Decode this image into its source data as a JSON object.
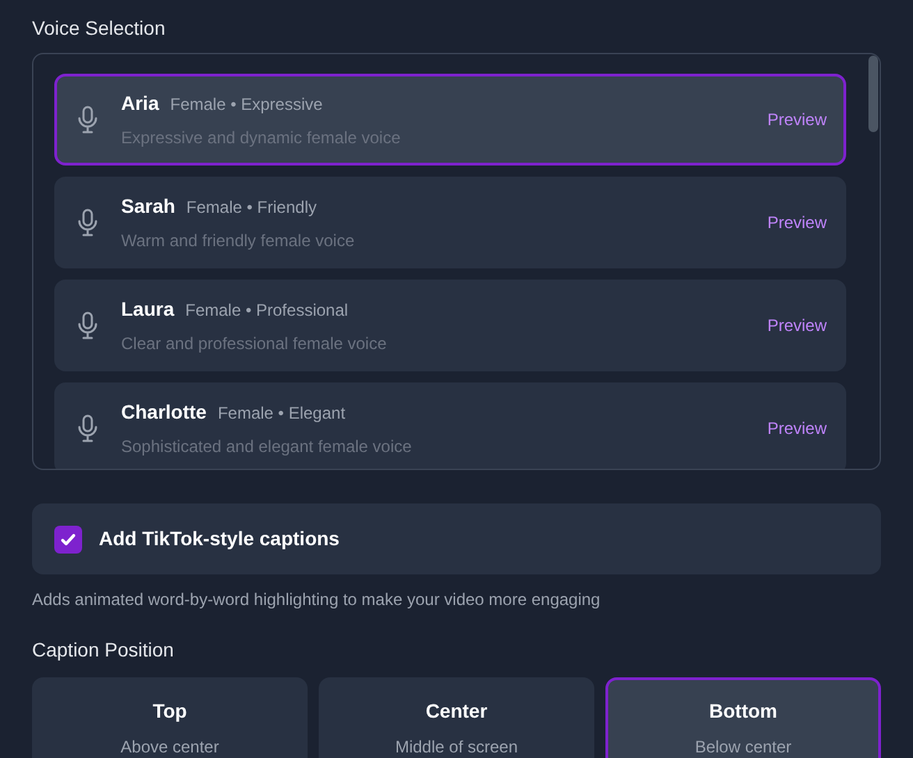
{
  "voice_selection": {
    "title": "Voice Selection",
    "voices": [
      {
        "name": "Aria",
        "tags": "Female • Expressive",
        "description": "Expressive and dynamic female voice",
        "action": "Preview",
        "selected": true
      },
      {
        "name": "Sarah",
        "tags": "Female • Friendly",
        "description": "Warm and friendly female voice",
        "action": "Preview",
        "selected": false
      },
      {
        "name": "Laura",
        "tags": "Female • Professional",
        "description": "Clear and professional female voice",
        "action": "Preview",
        "selected": false
      },
      {
        "name": "Charlotte",
        "tags": "Female • Elegant",
        "description": "Sophisticated and elegant female voice",
        "action": "Preview",
        "selected": false
      }
    ]
  },
  "captions": {
    "label": "Add TikTok-style captions",
    "checked": true,
    "help": "Adds animated word-by-word highlighting to make your video more engaging"
  },
  "caption_position": {
    "title": "Caption Position",
    "options": [
      {
        "label": "Top",
        "description": "Above center",
        "selected": false
      },
      {
        "label": "Center",
        "description": "Middle of screen",
        "selected": false
      },
      {
        "label": "Bottom",
        "description": "Below center",
        "selected": true
      }
    ]
  }
}
